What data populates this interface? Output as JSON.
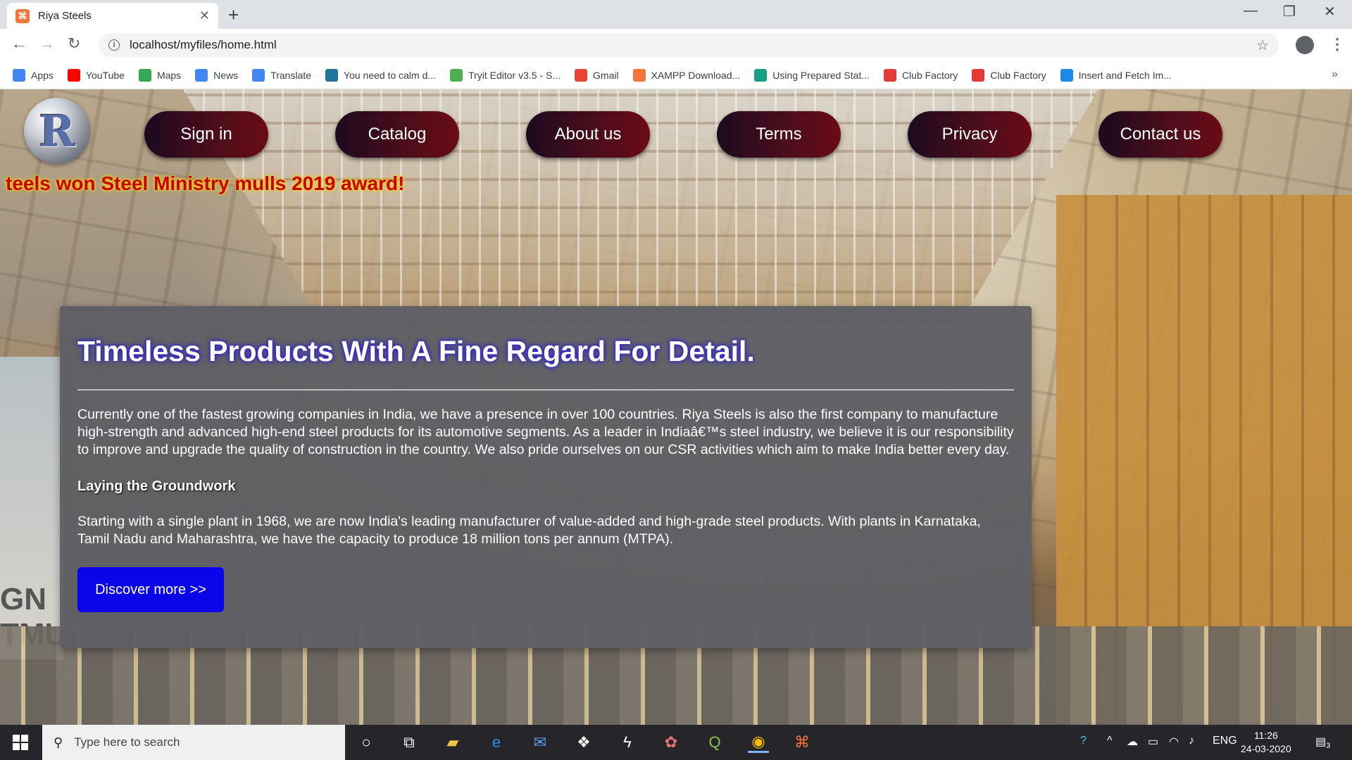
{
  "browser": {
    "tab_title": "Riya Steels",
    "tab_favicon": "xampp-icon",
    "url": "localhost/myfiles/home.html",
    "bookmarks": [
      {
        "label": "Apps",
        "icon": "apps-grid-icon",
        "color": "#4285f4"
      },
      {
        "label": "YouTube",
        "icon": "youtube-icon",
        "color": "#ff0000"
      },
      {
        "label": "Maps",
        "icon": "maps-icon",
        "color": "#34a853"
      },
      {
        "label": "News",
        "icon": "news-icon",
        "color": "#4285f4"
      },
      {
        "label": "Translate",
        "icon": "translate-icon",
        "color": "#4285f4"
      },
      {
        "label": "You need to calm d...",
        "icon": "wordpress-icon",
        "color": "#21759b"
      },
      {
        "label": "Tryit Editor v3.5 - S...",
        "icon": "w3schools-icon",
        "color": "#4caf50"
      },
      {
        "label": "Gmail",
        "icon": "gmail-icon",
        "color": "#ea4335"
      },
      {
        "label": "XAMPP Download...",
        "icon": "xampp-icon",
        "color": "#f4743b"
      },
      {
        "label": "Using Prepared Stat...",
        "icon": "shield-icon",
        "color": "#16a085"
      },
      {
        "label": "Club Factory",
        "icon": "clubfactory-icon",
        "color": "#e53935"
      },
      {
        "label": "Club Factory",
        "icon": "clubfactory-icon",
        "color": "#e53935"
      },
      {
        "label": "Insert and Fetch Im...",
        "icon": "w-icon",
        "color": "#1e88e5"
      }
    ],
    "bookmarks_more": "»"
  },
  "page": {
    "logo_letter": "R",
    "nav": [
      "Sign in",
      "Catalog",
      "About us",
      "Terms",
      "Privacy",
      "Contact us"
    ],
    "marquee": "teels won Steel Ministry mulls 2019 award!",
    "panel": {
      "heading": "Timeless Products With A Fine Regard For Detail.",
      "para1": "Currently one of the fastest growing companies in India, we have a presence in over 100 countries. Riya Steels is also the first company to manufacture high-strength and advanced high-end steel products for its automotive segments. As a leader in Indiaâ€™s steel industry, we believe it is our responsibility to improve and upgrade the quality of construction in the country. We also pride ourselves on our CSR activities which aim to make India better every day.",
      "subheading": "Laying the Groundwork",
      "para2": "Starting with a single plant in 1968, we are now India's leading manufacturer of value-added and high-grade steel products. With plants in Karnataka, Tamil Nadu and Maharashtra, we have the capacity to produce 18 million tons per annum (MTPA).",
      "button": "Discover more >>"
    },
    "background_text": "GN\nTMU"
  },
  "taskbar": {
    "search_placeholder": "Type here to search",
    "language": "ENG",
    "time": "11:26",
    "date": "24-03-2020",
    "notification_count": "3"
  }
}
